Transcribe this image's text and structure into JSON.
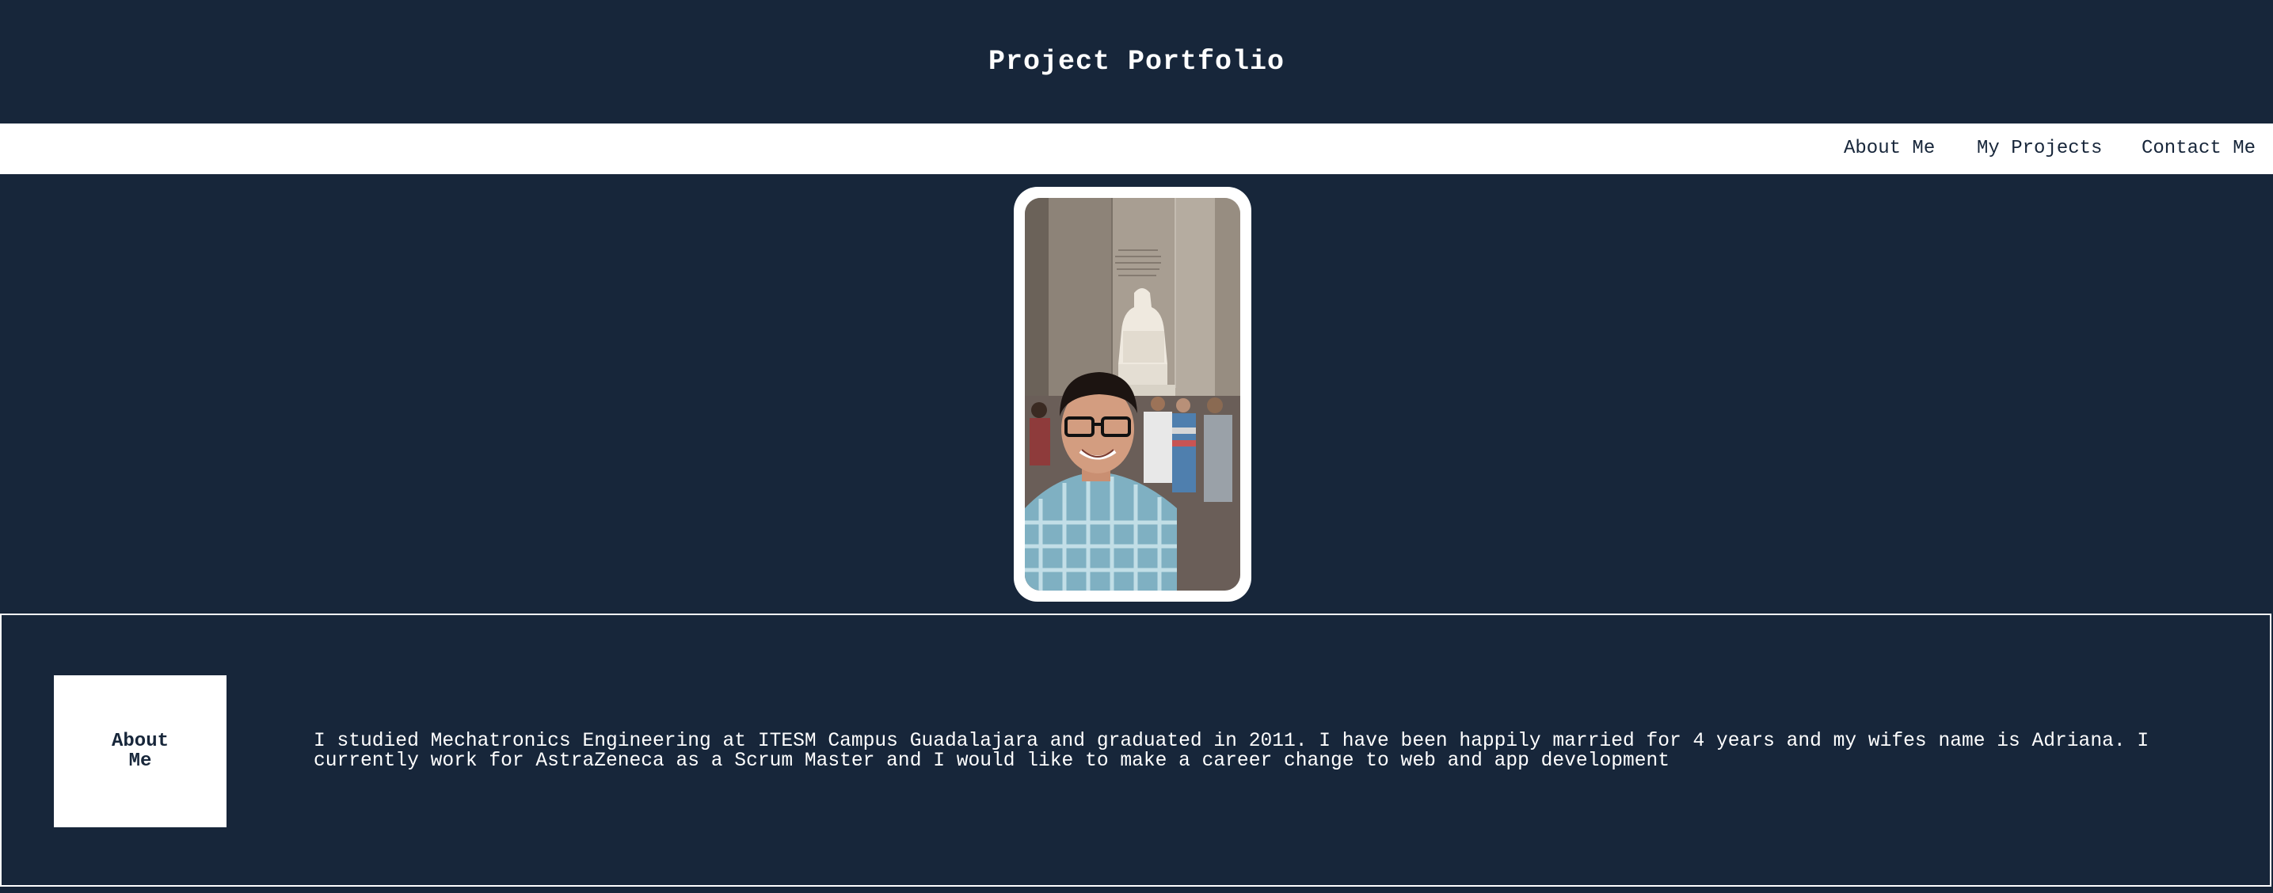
{
  "header": {
    "title": "Project Portfolio"
  },
  "nav": {
    "items": [
      {
        "label": "About Me"
      },
      {
        "label": "My Projects"
      },
      {
        "label": "Contact Me"
      }
    ]
  },
  "profile": {
    "photo_description": "photo-of-man-at-lincoln-memorial"
  },
  "about": {
    "heading": "About Me",
    "text": "I studied Mechatronics Engineering at ITESM Campus Guadalajara and graduated in 2011. I have been happily married for 4 years and my wifes name is Adriana. I currently work for AstraZeneca as a Scrum Master and I would like to make a career change to web and app development"
  },
  "colors": {
    "background": "#17263a",
    "nav_background": "#ffffff",
    "text_light": "#ffffff",
    "text_dark": "#17263a"
  }
}
